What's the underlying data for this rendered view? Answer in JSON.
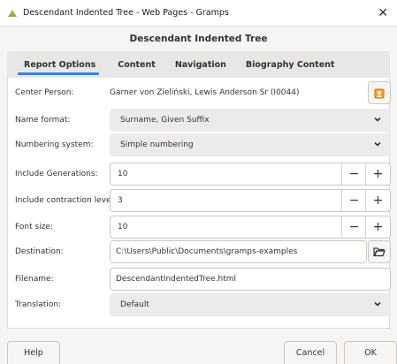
{
  "window": {
    "title": "Descendant Indented Tree - Web Pages - Gramps",
    "close_glyph": "✕"
  },
  "dialog": {
    "header": "Descendant Indented Tree"
  },
  "tabs": [
    {
      "label": "Report Options",
      "active": true
    },
    {
      "label": "Content"
    },
    {
      "label": "Navigation"
    },
    {
      "label": "Biography Content"
    }
  ],
  "options": {
    "center_person": {
      "label": "Center Person:",
      "value": "Garner von Zieliński, Lewis Anderson Sr (I0044)"
    },
    "name_format": {
      "label": "Name format:",
      "value": "Surname, Given Suffix"
    },
    "numbering_system": {
      "label": "Numbering system:",
      "value": "Simple numbering"
    },
    "include_generations": {
      "label": "Include Generations:",
      "value": "10"
    },
    "contraction_level": {
      "label": "Include contraction level:",
      "value": "3"
    },
    "font_size": {
      "label": "Font size:",
      "value": "10"
    },
    "destination": {
      "label": "Destination:",
      "value": "C:\\Users\\Public\\Documents\\gramps-examples"
    },
    "filename": {
      "label": "Filename:",
      "value": "DescendantIndentedTree.html"
    },
    "translation": {
      "label": "Translation:",
      "value": "Default"
    }
  },
  "spin": {
    "minus": "−",
    "plus": "+"
  },
  "buttons": {
    "help": "Help",
    "cancel": "Cancel",
    "ok": "OK"
  },
  "colors": {
    "accent": "#3584e4",
    "person_icon": "#e66100"
  }
}
